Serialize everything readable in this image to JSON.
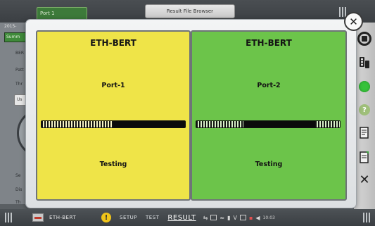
{
  "background": {
    "port_tab_label": "Port 1",
    "file_browser_tab_label": "Result File Browser",
    "date_fragment": "2015-",
    "summary_tab_label": "Summ",
    "left_labels": [
      "BER",
      "Patt",
      "Thr",
      "Se",
      "Dis",
      "Th"
    ],
    "select_value": "Us"
  },
  "modal": {
    "close_glyph": "✕",
    "panels": [
      {
        "title": "ETH-BERT",
        "port": "Port-1",
        "status": "Testing",
        "progress": 0.5,
        "color": "#efe448"
      },
      {
        "title": "ETH-BERT",
        "port": "Port-2",
        "status": "Testing",
        "progress_segments": [
          0.0,
          0.33,
          0.83,
          1.0
        ],
        "color": "#6cc44a"
      }
    ]
  },
  "side_toolbar": {
    "icons": [
      "stop-icon",
      "traffic-icon",
      "status-led-icon",
      "help-icon",
      "report-icon",
      "report-edit-icon",
      "close-icon"
    ],
    "led_color": "#36c23a"
  },
  "bottom_bar": {
    "app_name": "ETH-BERT",
    "warning_glyph": "!",
    "nav": {
      "setup": "SETUP",
      "test": "TEST",
      "result": "RESULT"
    },
    "time": "10:03"
  }
}
